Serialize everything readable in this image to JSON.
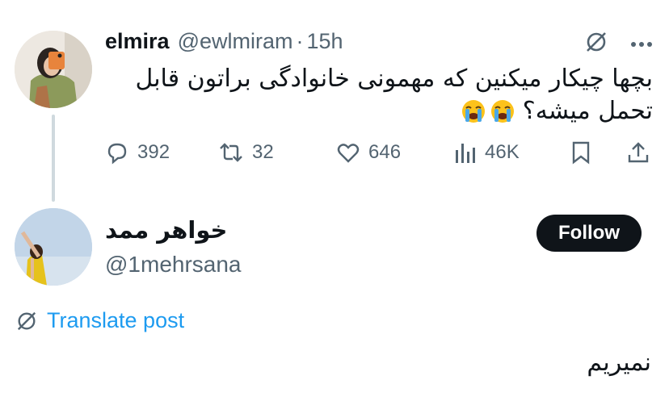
{
  "tweet": {
    "author_name": "elmira",
    "author_handle": "@ewlmiram",
    "separator": "·",
    "time": "15h",
    "text": "بچها چیکار میکنین که مهمونی خانوادگی براتون قابل تحمل میشه؟",
    "emoji": [
      "loudly-crying-face",
      "loudly-crying-face"
    ],
    "actions": {
      "replies": "392",
      "reposts": "32",
      "likes": "646",
      "views": "46K"
    }
  },
  "reply": {
    "author_name": "خواهر ممد",
    "author_handle": "@1mehrsana",
    "follow_label": "Follow",
    "translate_label": "Translate post",
    "text": "نمیریم"
  },
  "colors": {
    "text": "#0f1419",
    "secondary": "#536471",
    "link": "#1d9bf0",
    "button": "#0f1419",
    "thread_line": "#cfd9de"
  }
}
